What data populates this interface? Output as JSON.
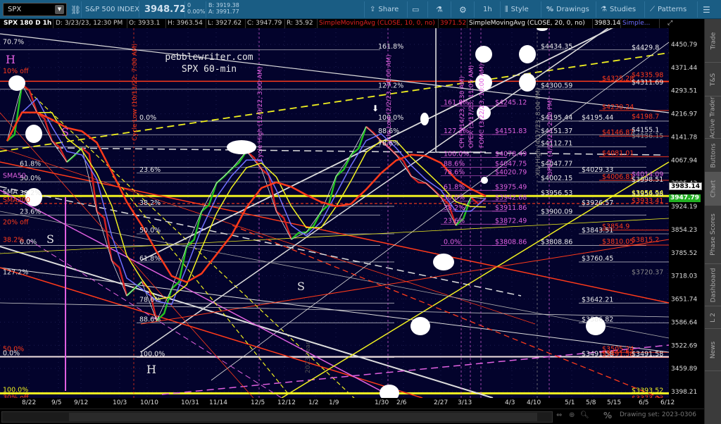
{
  "header": {
    "symbol": "SPX",
    "name": "S&P 500 INDEX",
    "last": "3948.72",
    "change": "0",
    "change_pct": "0.00%",
    "bid": "B: 3919.38",
    "ask": "A: 3991.77",
    "share": "Share",
    "timeframe": "1h",
    "style": "Style",
    "drawings": "Drawings",
    "studies": "Studies",
    "patterns": "Patterns"
  },
  "info": {
    "chart_desc": "SPX 180 D 1h",
    "date": "D: 3/23/23, 12:30 PM",
    "open": "O: 3933.1",
    "high": "H: 3963.54",
    "low": "L: 3927.62",
    "close": "C: 3947.79",
    "range": "R: 35.92",
    "sma10_label": "SimpleMovingAvg (CLOSE, 10, 0, no)",
    "sma10_value": "3971.52",
    "sma20_label": "SimpleMovingAvg (CLOSE, 20, 0, no)",
    "sma20_value": "3983.14",
    "sma3_label": "Simple..."
  },
  "watermark": {
    "line1": "pebblewriter.com",
    "line2": "SPX 60-min"
  },
  "price_axis": [
    "4450.79",
    "4371.44",
    "4293.51",
    "4216.97",
    "4141.78",
    "4067.94",
    "3995.42",
    "3924.19",
    "3854.23",
    "3785.52",
    "3718.03",
    "3651.74",
    "3586.64",
    "3522.69",
    "3459.89",
    "3398.21"
  ],
  "price_markers": {
    "sma20": "3983.14",
    "last": "3947.79"
  },
  "date_axis": [
    "8/22",
    "9/5",
    "9/12",
    "10/3",
    "10/10",
    "10/31",
    "11/14",
    "12/5",
    "12/12",
    "1/2",
    "1/9",
    "1/30",
    "2/6",
    "2/27",
    "3/13",
    "4/3",
    "4/10",
    "5/1",
    "5/8",
    "5/15",
    "6/5",
    "6/12"
  ],
  "price_series": [
    4129,
    4314,
    4221,
    4129,
    4062,
    4107,
    3909,
    3762,
    3661,
    3701,
    3591,
    3681,
    3804,
    3909,
    3996,
    4040,
    4096,
    4040,
    3909,
    3825,
    3846,
    3909,
    4018,
    4085,
    4175,
    4129,
    4085,
    4018,
    3996,
    3952,
    3867,
    3952,
    3948
  ],
  "colors": {
    "bg": "#03032c",
    "white": "#e8e8e8",
    "red": "#ff3a1a",
    "magenta": "#e060e0",
    "yellow": "#f0f020",
    "gray": "#888888",
    "green": "#22c022",
    "blue": "#7070ff"
  },
  "level_groups": [
    {
      "color": "#e8e8e8",
      "items": [
        {
          "text": "0.0%",
          "price": 4195.44
        },
        {
          "text": "23.6%",
          "price": 4029.33
        },
        {
          "text": "38.2%",
          "price": 3926.57
        },
        {
          "text": "50.0%",
          "price": 3843.51
        },
        {
          "text": "61.8%",
          "price": 3760.45
        },
        {
          "text": "78.6%",
          "price": 3642.21
        },
        {
          "text": "88.6%",
          "price": 3586.82
        },
        {
          "text": "100.0%",
          "price": 3491.58
        }
      ]
    },
    {
      "color": "#e8e8e8",
      "items": [
        {
          "text": "161.8%",
          "price": 4434.35
        },
        {
          "text": "127.2%",
          "price": 4300.59
        },
        {
          "text": "100.0%",
          "price": 4195.44
        },
        {
          "text": "88.6%",
          "price": 4151.37
        },
        {
          "text": "78.6%",
          "price": 4112.71
        },
        {
          "text": "61.8%",
          "price": 4047.77
        },
        {
          "text": "50.0%",
          "price": 4002.15
        },
        {
          "text": "38.2%",
          "price": 3956.53
        },
        {
          "text": "23.6%",
          "price": 3900.09
        },
        {
          "text": "0.0%",
          "price": 3808.86
        }
      ]
    },
    {
      "color": "#e060e0",
      "items": [
        {
          "text": "161.8%",
          "price": 4245.12
        },
        {
          "text": "127.2%",
          "price": 4151.83
        },
        {
          "text": "100.0%",
          "price": 4078.49
        },
        {
          "text": "88.6%",
          "price": 4047.75
        },
        {
          "text": "78.6%",
          "price": 4020.79
        },
        {
          "text": "61.8%",
          "price": 3975.49
        },
        {
          "text": "50.0%",
          "price": 3942.68
        },
        {
          "text": "38.2%",
          "price": 3911.86
        },
        {
          "text": "23.6%",
          "price": 3872.49
        },
        {
          "text": "0.0%",
          "price": 3808.86
        }
      ]
    },
    {
      "color": "#e060e0",
      "items": [
        {
          "text": "$4245.12",
          "price": 4245.12
        },
        {
          "text": "$4151.83",
          "price": 4151.83
        },
        {
          "text": "$4078.49",
          "price": 4078.49
        },
        {
          "text": "$4047.75",
          "price": 4047.75
        },
        {
          "text": "$4020.79",
          "price": 4020.79
        },
        {
          "text": "$3975.49",
          "price": 3975.49
        },
        {
          "text": "$3942.68",
          "price": 3942.68
        },
        {
          "text": "$3911.86",
          "price": 3911.86
        },
        {
          "text": "$3872.49",
          "price": 3872.49
        },
        {
          "text": "$3808.86",
          "price": 3808.86
        }
      ]
    },
    {
      "color": "#e8e8e8",
      "items": [
        {
          "text": "$4434.35",
          "price": 4434.35
        },
        {
          "text": "$4300.59",
          "price": 4300.59
        },
        {
          "text": "$4195.44",
          "price": 4195.44
        },
        {
          "text": "$4151.37",
          "price": 4151.37
        },
        {
          "text": "$4112.71",
          "price": 4112.71
        },
        {
          "text": "$4047.77",
          "price": 4047.77
        },
        {
          "text": "$4002.15",
          "price": 4002.15
        },
        {
          "text": "$3956.53",
          "price": 3956.53
        },
        {
          "text": "$3900.09",
          "price": 3900.09
        },
        {
          "text": "$3808.86",
          "price": 3808.86
        }
      ]
    },
    {
      "color": "#e8e8e8",
      "items": [
        {
          "text": "$4195.44",
          "price": 4195.44
        },
        {
          "text": "$4029.33",
          "price": 4029.33
        },
        {
          "text": "$3926.57",
          "price": 3926.57
        },
        {
          "text": "$3843.51",
          "price": 3843.51
        },
        {
          "text": "$3760.45",
          "price": 3760.45
        },
        {
          "text": "$3642.21",
          "price": 3642.21
        },
        {
          "text": "$3586.82",
          "price": 3586.82
        },
        {
          "text": "$3491.58",
          "price": 3491.58
        }
      ]
    },
    {
      "color": "#ff3a1a",
      "items": [
        {
          "text": "$4325.28",
          "price": 4325.28
        },
        {
          "text": "$4230.24",
          "price": 4230.24
        },
        {
          "text": "$4146.87",
          "price": 4146.87
        },
        {
          "text": "$4081.01",
          "price": 4081.01
        },
        {
          "text": "$4006.81",
          "price": 4006.81
        },
        {
          "text": "$3854.9",
          "price": 3854.9
        },
        {
          "text": "$3810.05",
          "price": 3810.05
        },
        {
          "text": "$3505.24",
          "price": 3505.24
        },
        {
          "text": "$3491.58",
          "price": 3491.58
        }
      ]
    },
    {
      "color": "#e8e8e8",
      "items": [
        {
          "text": "$4429.8",
          "price": 4429.8
        },
        {
          "text": "$4311.69",
          "price": 4311.69
        },
        {
          "text": "$4155.1",
          "price": 4155.1
        },
        {
          "text": "$3998.51",
          "price": 3998.51
        },
        {
          "text": "$3954.98",
          "price": 3954.98
        },
        {
          "text": "$3491.58",
          "price": 3491.58
        }
      ]
    },
    {
      "color": "#ff3a1a",
      "items": [
        {
          "text": "$4335.98",
          "price": 4335.98
        },
        {
          "text": "$4198.7",
          "price": 4198.7
        },
        {
          "text": "$3933.41",
          "price": 3933.41
        },
        {
          "text": "$3815.2",
          "price": 3815.2
        },
        {
          "text": "$3373.03",
          "price": 3373.03
        }
      ]
    },
    {
      "color": "#888888",
      "items": [
        {
          "text": "$4136.15",
          "price": 4136.15
        },
        {
          "text": "$3720.37",
          "price": 3720.37
        }
      ]
    },
    {
      "color": "#e060e0",
      "items": [
        {
          "text": "$4014.09",
          "price": 4014.09
        }
      ]
    },
    {
      "color": "#f0f020",
      "items": [
        {
          "text": "$3956.54",
          "price": 3956.54
        },
        {
          "text": "$3393.52",
          "price": 3393.52
        }
      ]
    },
    {
      "color": "#e8e8e8",
      "items": [
        {
          "text": "70.7%",
          "price": 4450.0
        },
        {
          "text": "127.2%",
          "price": 3720.37
        }
      ]
    },
    {
      "color": "#ff3a1a",
      "items": [
        {
          "text": "10% off",
          "price": 4350
        },
        {
          "text": "SMA200",
          "price": 3935
        },
        {
          "text": "20% off",
          "price": 3868
        },
        {
          "text": "38.2%",
          "price": 3815
        },
        {
          "text": "50.0%",
          "price": 3505
        },
        {
          "text": "30% off",
          "price": 3375
        }
      ]
    },
    {
      "color": "#e060e0",
      "items": [
        {
          "text": "SMA50",
          "price": 4010
        }
      ]
    },
    {
      "color": "#e8e8e8",
      "items": [
        {
          "text": "SMA",
          "price": 3960
        },
        {
          "text": "0.0%",
          "price": 3493
        }
      ]
    },
    {
      "color": "#f0f020",
      "items": [
        {
          "text": "100.0%",
          "price": 3395
        }
      ]
    }
  ],
  "events": [
    {
      "label": "Cycle Low (10/13/22, 7:00 AM)",
      "color": "#ff3a1a"
    },
    {
      "label": "Cycle High (12/9/22, 3:00 AM)",
      "color": "#e060e0"
    },
    {
      "label": "Cycle Low (2/2/23, 10:00 AM)",
      "color": "#e060e0"
    },
    {
      "label": "CPI (3/14/23, 5:30 AM)",
      "color": "#e060e0"
    },
    {
      "label": "OPEX (3/17/23, 11:05 AM)",
      "color": "#e060e0"
    },
    {
      "label": "FOMC (3/22/23, 10:00 AM)",
      "color": "#e060e0"
    },
    {
      "label": "XIU High (4/17/23, 8:04 PM)",
      "color": "#888888"
    },
    {
      "label": "OPEX (4/21/23, 2:00 PM)",
      "color": "#e060e0"
    }
  ],
  "pattern_marks": [
    {
      "text": "H",
      "color": "#e060e0"
    },
    {
      "text": "S",
      "color": "#e060e0"
    },
    {
      "text": "S",
      "color": "#e8e8e8"
    },
    {
      "text": "S",
      "color": "#e8e8e8"
    },
    {
      "text": "H",
      "color": "#e8e8e8"
    }
  ],
  "year_marker": "2023 Year",
  "sidebar_tabs": [
    "Trade",
    "T&S",
    "Active Trader",
    "Buttons",
    "Chart",
    "Phase Scores",
    "Dashboard",
    "L 2",
    "News"
  ],
  "footer": {
    "drawing_set": "Drawing set: 2023-0306"
  }
}
